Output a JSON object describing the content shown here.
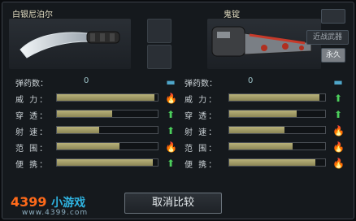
{
  "left": {
    "weapon_name": "白银尼泊尔",
    "ammo_label": "弹药数：",
    "ammo_value": "0",
    "buttons": [],
    "rows": [
      {
        "label": "威  力：",
        "fill": 0.97,
        "indicator": "fire"
      },
      {
        "label": "穿  透：",
        "fill": 0.55,
        "indicator": "up"
      },
      {
        "label": "射  速：",
        "fill": 0.42,
        "indicator": "up"
      },
      {
        "label": "范  围：",
        "fill": 0.62,
        "indicator": "fire"
      },
      {
        "label": "便  携：",
        "fill": 0.95,
        "indicator": "up"
      }
    ],
    "ammo_indicator": "dash"
  },
  "right": {
    "weapon_name": "鬼锭",
    "ammo_label": "弹药数：",
    "ammo_value": "0",
    "side_buttons": [
      "近战武器",
      "永久"
    ],
    "top_tag": "永久",
    "rows": [
      {
        "label": "威  力：",
        "fill": 0.94,
        "indicator": "up"
      },
      {
        "label": "穿  透：",
        "fill": 0.7,
        "indicator": "up"
      },
      {
        "label": "射  速：",
        "fill": 0.58,
        "indicator": "fire"
      },
      {
        "label": "范  围：",
        "fill": 0.66,
        "indicator": "fire"
      },
      {
        "label": "便  携：",
        "fill": 0.9,
        "indicator": "fire"
      }
    ],
    "ammo_indicator": "dash"
  },
  "bottom": {
    "cancel_label": "取消比较",
    "logo_text": "4399",
    "logo_sub": "小游戏",
    "logo_url": "www.4399.com"
  },
  "colors": {
    "accent_fire": "#ff8b28",
    "accent_up": "#4ccf5c",
    "accent_dash": "#4fa6c9"
  }
}
